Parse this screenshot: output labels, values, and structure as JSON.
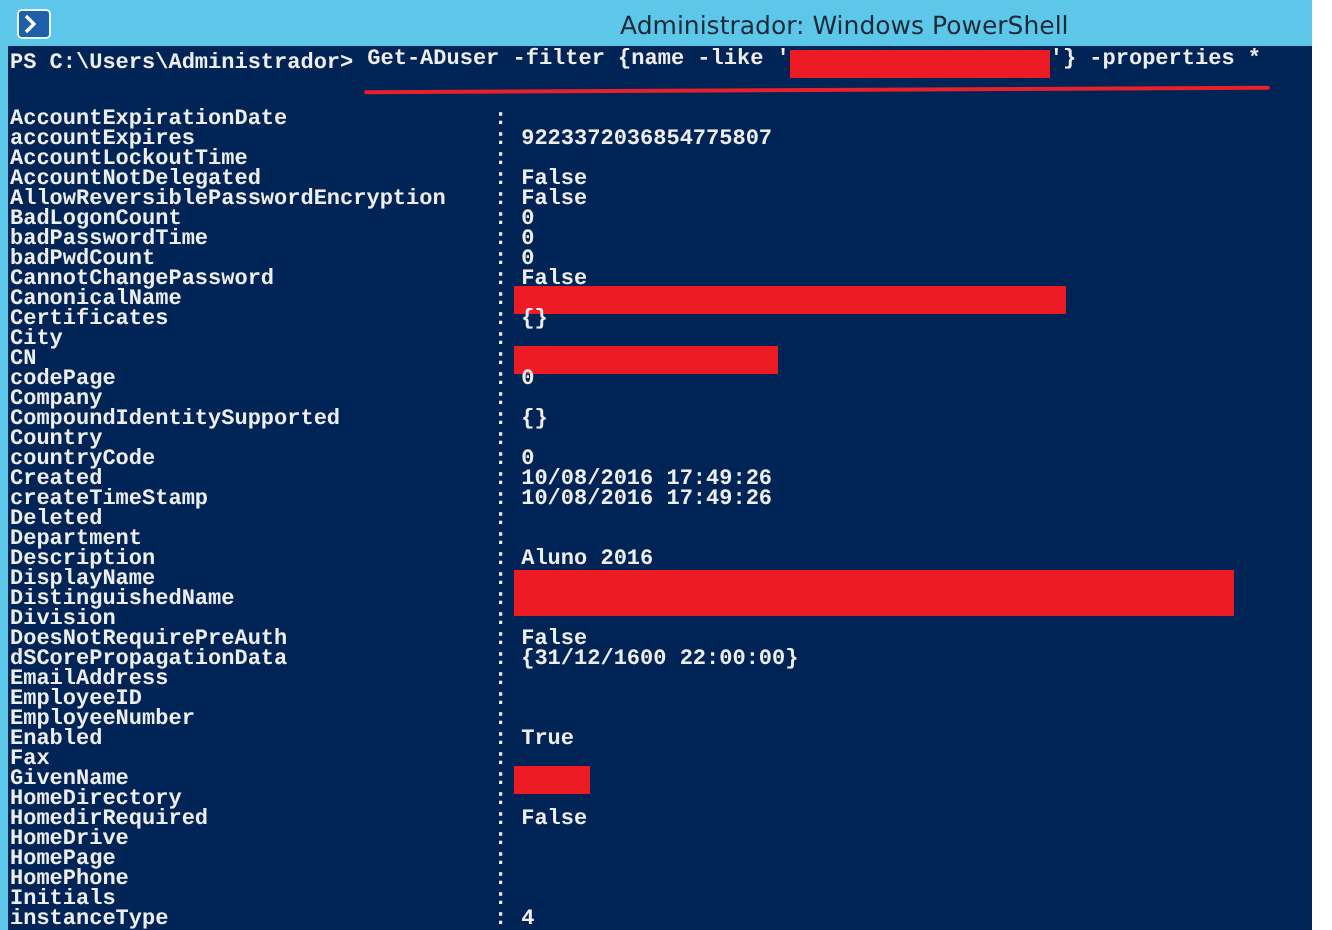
{
  "window": {
    "title": "Administrador: Windows PowerShell"
  },
  "command": {
    "prompt": "PS C:\\Users\\Administrador>",
    "before": "Get-ADuser -filter {name -like '",
    "redacted": true,
    "after": "'} -properties *"
  },
  "properties": [
    {
      "name": "AccountExpirationDate",
      "separator": ":",
      "redacted": false
    },
    {
      "name": "accountExpires",
      "separator": ":",
      "value": "9223372036854775807",
      "redacted": false
    },
    {
      "name": "AccountLockoutTime",
      "separator": ":",
      "redacted": false
    },
    {
      "name": "AccountNotDelegated",
      "separator": ":",
      "value": "False",
      "redacted": false
    },
    {
      "name": "AllowReversiblePasswordEncryption",
      "separator": ":",
      "value": "False",
      "redacted": false
    },
    {
      "name": "BadLogonCount",
      "separator": ":",
      "value": "0",
      "redacted": false
    },
    {
      "name": "badPasswordTime",
      "separator": ":",
      "value": "0",
      "redacted": false
    },
    {
      "name": "badPwdCount",
      "separator": ":",
      "value": "0",
      "redacted": false
    },
    {
      "name": "CannotChangePassword",
      "separator": ":",
      "value": "False",
      "redacted": false
    },
    {
      "name": "CanonicalName",
      "separator": ":",
      "redacted": true
    },
    {
      "name": "Certificates",
      "separator": ":",
      "value": "{}",
      "redacted": false
    },
    {
      "name": "City",
      "separator": ":",
      "redacted": false
    },
    {
      "name": "CN",
      "separator": ":",
      "redacted": true
    },
    {
      "name": "codePage",
      "separator": ":",
      "value": "0",
      "redacted": false
    },
    {
      "name": "Company",
      "separator": ":",
      "redacted": false
    },
    {
      "name": "CompoundIdentitySupported",
      "separator": ":",
      "value": "{}",
      "redacted": false
    },
    {
      "name": "Country",
      "separator": ":",
      "redacted": false
    },
    {
      "name": "countryCode",
      "separator": ":",
      "value": "0",
      "redacted": false
    },
    {
      "name": "Created",
      "separator": ":",
      "value": "10/08/2016 17:49:26",
      "redacted": false
    },
    {
      "name": "createTimeStamp",
      "separator": ":",
      "value": "10/08/2016 17:49:26",
      "redacted": false
    },
    {
      "name": "Deleted",
      "separator": ":",
      "redacted": false
    },
    {
      "name": "Department",
      "separator": ":",
      "redacted": false
    },
    {
      "name": "Description",
      "separator": ":",
      "value": "Aluno 2016",
      "redacted": false
    },
    {
      "name": "DisplayName",
      "separator": ":",
      "redacted": true
    },
    {
      "name": "DistinguishedName",
      "separator": ":",
      "redacted": true
    },
    {
      "name": "Division",
      "separator": ":",
      "redacted": false
    },
    {
      "name": "DoesNotRequirePreAuth",
      "separator": ":",
      "value": "False",
      "redacted": false
    },
    {
      "name": "dSCorePropagationData",
      "separator": ":",
      "value": "{31/12/1600 22:00:00}",
      "redacted": false
    },
    {
      "name": "EmailAddress",
      "separator": ":",
      "redacted": false
    },
    {
      "name": "EmployeeID",
      "separator": ":",
      "redacted": false
    },
    {
      "name": "EmployeeNumber",
      "separator": ":",
      "redacted": false
    },
    {
      "name": "Enabled",
      "separator": ":",
      "value": "True",
      "redacted": false
    },
    {
      "name": "Fax",
      "separator": ":",
      "redacted": false
    },
    {
      "name": "GivenName",
      "separator": ":",
      "redacted": true
    },
    {
      "name": "HomeDirectory",
      "separator": ":",
      "redacted": false
    },
    {
      "name": "HomedirRequired",
      "separator": ":",
      "value": "False",
      "redacted": false
    },
    {
      "name": "HomeDrive",
      "separator": ":",
      "redacted": false
    },
    {
      "name": "HomePage",
      "separator": ":",
      "redacted": false
    },
    {
      "name": "HomePhone",
      "separator": ":",
      "redacted": false
    },
    {
      "name": "Initials",
      "separator": ":",
      "redacted": false
    },
    {
      "name": "instanceType",
      "separator": ":",
      "value": "4",
      "redacted": false
    }
  ]
}
